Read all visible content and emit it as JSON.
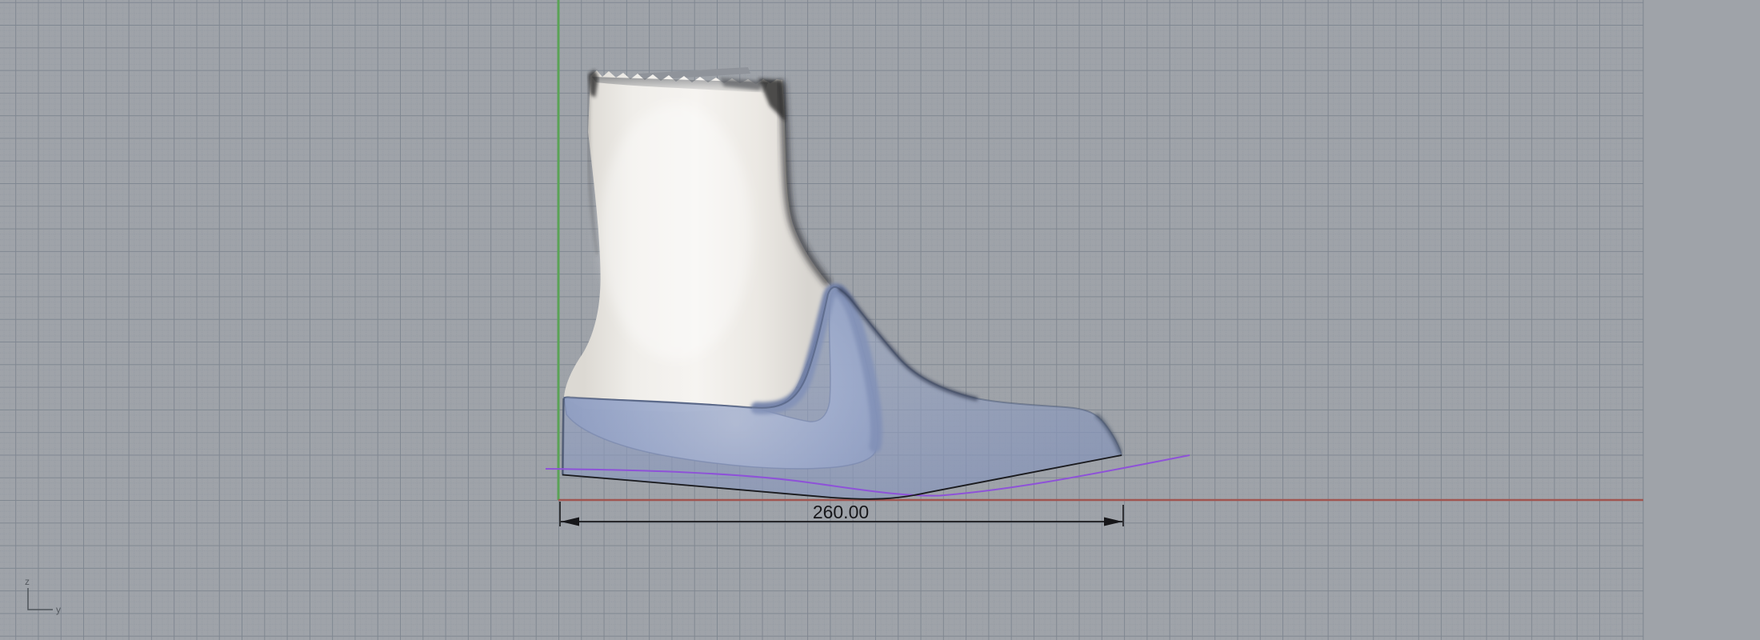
{
  "viewport": {
    "dimension": {
      "value": "260.00"
    },
    "axis_gizmo": {
      "z_label": "z",
      "y_label": "y"
    },
    "colors": {
      "background": "#9fa3a9",
      "grid_minor": "#8a919b",
      "grid_major": "#7a828d",
      "axis_green": "#5aa356",
      "axis_red": "#a05550",
      "curve_purple": "#8e52d8",
      "sole_outline_black": "#1b1b1e",
      "dimension_black": "#17171a",
      "last_ivory": "#f3f1ed",
      "shoe_shell_blue": "#94a5c7",
      "lining_band_blue": "#8296c0",
      "gizmo_gray": "#4f545a"
    }
  }
}
